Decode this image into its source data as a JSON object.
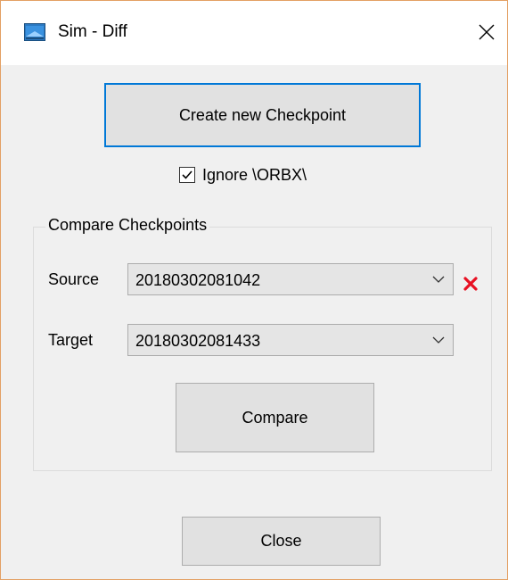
{
  "window": {
    "title": "Sim - Diff",
    "icon": "app-window-icon",
    "close_icon": "close-icon"
  },
  "toolbar": {
    "create_label": "Create new Checkpoint"
  },
  "options": {
    "ignore_label": "Ignore \\ORBX\\",
    "ignore_checked": true
  },
  "compare_group": {
    "title": "Compare Checkpoints",
    "source_label": "Source",
    "source_value": "20180302081042",
    "target_label": "Target",
    "target_value": "20180302081433",
    "compare_label": "Compare",
    "delete_icon": "delete-x-icon",
    "delete_color": "#e81123"
  },
  "footer": {
    "close_label": "Close"
  },
  "colors": {
    "accent": "#0078d7",
    "window_border": "#e3a064"
  }
}
